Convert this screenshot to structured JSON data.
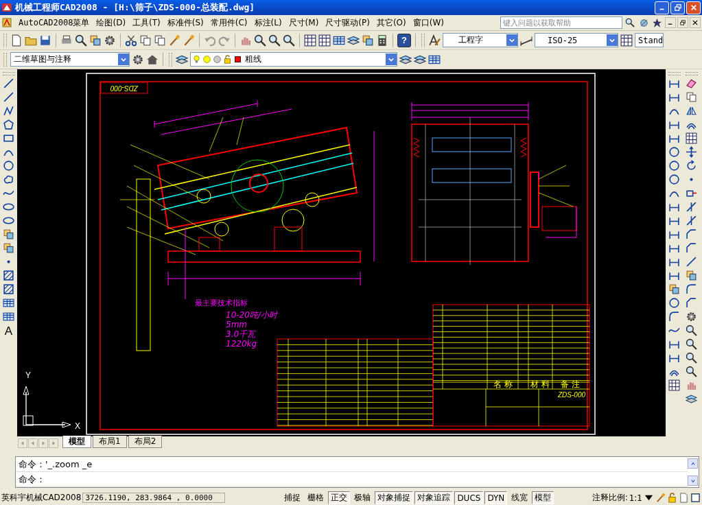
{
  "window": {
    "title": "机械工程师CAD2008 - [H:\\筛子\\ZDS-000-总装配.dwg]"
  },
  "menu": [
    "AutoCAD2008菜单",
    "绘图(D)",
    "工具(T)",
    "标准件(S)",
    "常用件(C)",
    "标注(L)",
    "尺寸(M)",
    "尺寸驱动(P)",
    "其它(O)",
    "窗口(W)"
  ],
  "help_search": {
    "placeholder": "键入问题以获取帮助"
  },
  "help_glyph": "?",
  "styles": {
    "text_style": "工程字",
    "dim_style": "ISO-25",
    "table_style": "Stand"
  },
  "workspace": "二维草图与注释",
  "layer": "粗线",
  "text_tool_glyph": "A",
  "drawing": {
    "sheet_code": "ZDS-000",
    "specs_title": "最主要技术指标",
    "specs": [
      "10-20吨/小时",
      "5mm",
      "3.0千瓦",
      "1220kg"
    ],
    "table_headers": [
      "名 称",
      "材 料",
      "备 注"
    ],
    "title_block_code": "ZDS-000",
    "ucs": {
      "x": "X",
      "y": "Y"
    }
  },
  "layout_tabs": [
    {
      "label": "模型",
      "selected": true
    },
    {
      "label": "布局1",
      "selected": false
    },
    {
      "label": "布局2",
      "selected": false
    }
  ],
  "command_lines": [
    "命令：'_.zoom _e",
    "命令："
  ],
  "status_bar": {
    "product": "英科宇机械CAD2008",
    "coordinates": "3726.1190, 283.9864 , 0.0000",
    "toggles": [
      {
        "label": "捕捉",
        "on": false
      },
      {
        "label": "栅格",
        "on": false
      },
      {
        "label": "正交",
        "on": true
      },
      {
        "label": "极轴",
        "on": false
      },
      {
        "label": "对象捕捉",
        "on": true
      },
      {
        "label": "对象追踪",
        "on": true
      },
      {
        "label": "DUCS",
        "on": true
      },
      {
        "label": "DYN",
        "on": true
      },
      {
        "label": "线宽",
        "on": false
      },
      {
        "label": "模型",
        "on": true
      }
    ],
    "annotation_scale_label": "注释比例:",
    "annotation_scale": "1:1"
  }
}
